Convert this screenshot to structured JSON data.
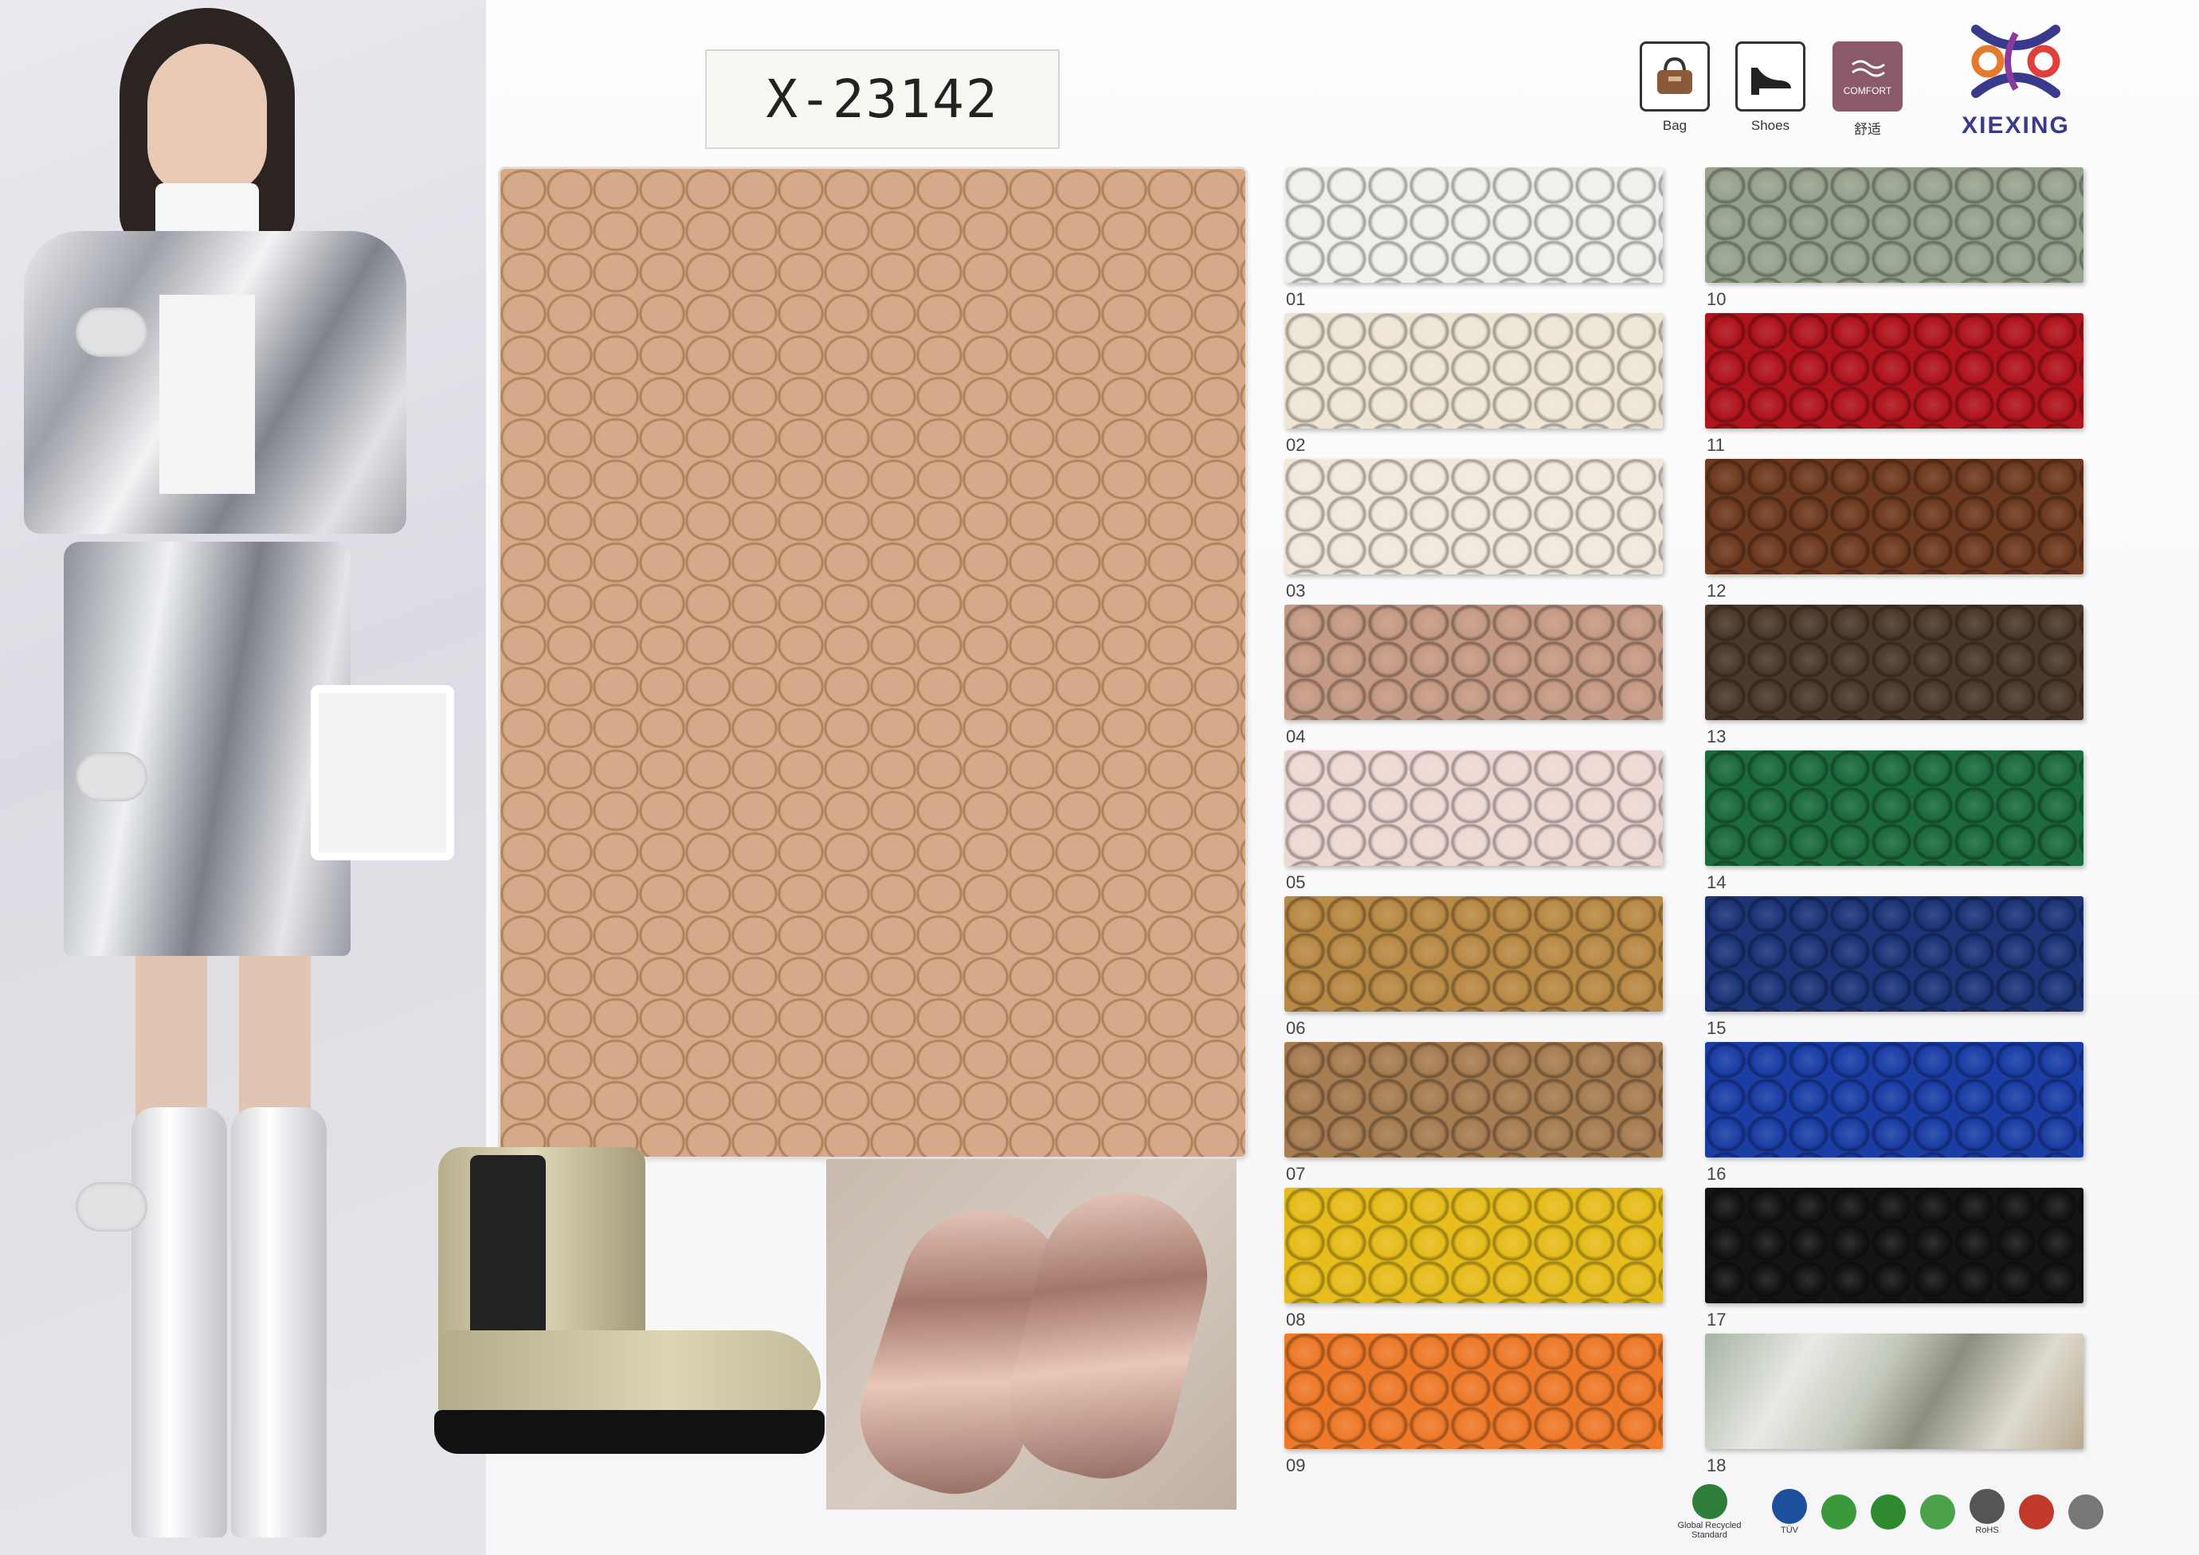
{
  "catalog": {
    "product_code": "X-23142",
    "brand_name": "XIEXING"
  },
  "usage_icons": [
    {
      "label": "Bag",
      "icon": "handbag-icon"
    },
    {
      "label": "Shoes",
      "icon": "shoe-icon"
    },
    {
      "label": "舒适",
      "icon": "comfort-icon",
      "badge_text": "COMFORT"
    }
  ],
  "main_swatch_color": "#d5a98a",
  "swatches_left": [
    {
      "num": "01",
      "color": "#f2f0ec"
    },
    {
      "num": "02",
      "color": "#efe6d6"
    },
    {
      "num": "03",
      "color": "#f1e9dc"
    },
    {
      "num": "04",
      "color": "#c59a84"
    },
    {
      "num": "05",
      "color": "#eed8d3"
    },
    {
      "num": "06",
      "color": "#b98a45"
    },
    {
      "num": "07",
      "color": "#a77d52"
    },
    {
      "num": "08",
      "color": "#e6bd1c"
    },
    {
      "num": "09",
      "color": "#ee7a2a"
    }
  ],
  "swatches_right": [
    {
      "num": "10",
      "color": "#97a38f"
    },
    {
      "num": "11",
      "color": "#b0141d"
    },
    {
      "num": "12",
      "color": "#6e3a20"
    },
    {
      "num": "13",
      "color": "#4b3a2c"
    },
    {
      "num": "14",
      "color": "#1d6b3e"
    },
    {
      "num": "15",
      "color": "#1d3478"
    },
    {
      "num": "16",
      "color": "#1b3ea6"
    },
    {
      "num": "17",
      "color": "#141414"
    },
    {
      "num": "18",
      "color": "nature-photo"
    }
  ],
  "certifications": [
    {
      "label": "Global Recycled Standard",
      "icon": "grs-icon"
    },
    {
      "label": "TÜV",
      "icon": "tuv-icon"
    },
    {
      "label": "",
      "icon": "leaf-icon"
    },
    {
      "label": "",
      "icon": "check-icon"
    },
    {
      "label": "",
      "icon": "eco-icon"
    },
    {
      "label": "RoHS",
      "icon": "rohs-icon"
    },
    {
      "label": "",
      "icon": "recycle-icon"
    },
    {
      "label": "",
      "icon": "reach-icon"
    }
  ]
}
